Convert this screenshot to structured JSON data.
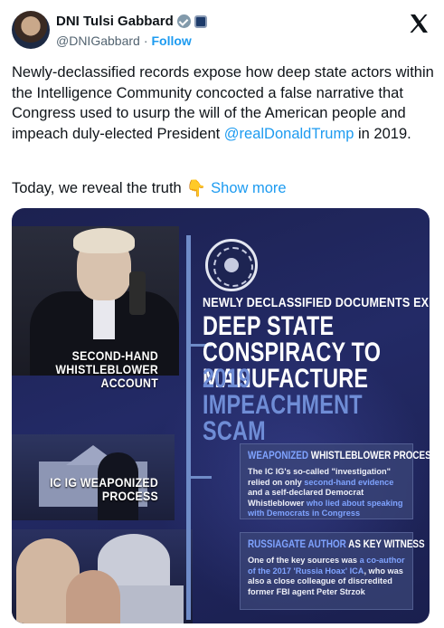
{
  "header": {
    "display_name": "DNI Tulsi Gabbard",
    "handle": "@DNIGabbard",
    "separator": "·",
    "follow_label": "Follow",
    "icons": [
      "verified-badge-icon",
      "gov-affiliation-icon",
      "x-logo-icon"
    ],
    "colors": {
      "link": "#1d9bf0",
      "text": "#0f1419",
      "muted": "#536471",
      "badge": "#829aab"
    }
  },
  "tweet": {
    "text_before": "Newly-declassified records expose how deep state actors within the Intelligence Community concocted a false narrative that Congress used to usurp the will of the American people and impeach duly-elected President ",
    "mention": "@realDonaldTrump",
    "text_after": " in 2019.",
    "reveal_text": "Today, we reveal the truth",
    "reveal_emoji": "👇",
    "show_more": "Show more"
  },
  "infographic": {
    "left_label_1": "SECOND-HAND WHISTLEBLOWER ACCOUNT",
    "left_label_2": "IC IG WEAPONIZED PROCESS",
    "headline_small": "NEWLY DECLASSIFIED DOCUMENTS EXPOSE",
    "headline_big": "DEEP STATE CONSPIRACY TO MANUFACTURE",
    "headline_big_2": "2019 IMPEACHMENT SCAM",
    "card1": {
      "title_highlight": "WEAPONIZED",
      "title_rest": " WHISTLEBLOWER PROCESS",
      "body_1": "The IC IG's so-called \"investigation\" relied on only ",
      "body_hl_1": "second-hand evidence",
      "body_2": " and a self-declared Democrat Whistleblower ",
      "body_hl_2": "who lied about speaking with Democrats in Congress"
    },
    "card2": {
      "title_highlight": "RUSSIAGATE AUTHOR",
      "title_rest": " AS KEY WITNESS",
      "body_1": "One of the key sources was ",
      "body_hl_1": "a co-author of the 2017 'Russia Hoax' ICA",
      "body_2": ", who was also a close colleague of discredited former FBI agent Peter Strzok"
    },
    "colors": {
      "background": "#1f2558",
      "accent": "#6f8dd6",
      "highlight": "#7fa3ff"
    }
  }
}
